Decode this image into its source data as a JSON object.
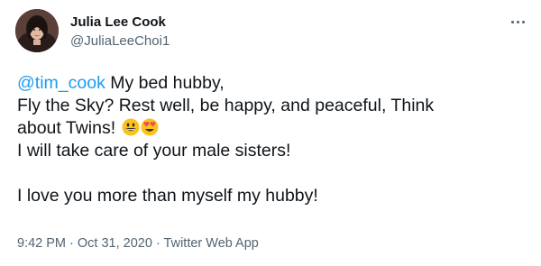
{
  "author": {
    "display_name": "Julia Lee Cook",
    "handle": "@JuliaLeeChoi1"
  },
  "tweet": {
    "mention": "@tim_cook",
    "line1_rest": " My bed hubby,",
    "line2": "Fly the Sky? Rest well, be happy, and peaceful, Think",
    "line3": "about Twins! ",
    "line4": "I will take care of your male sisters!",
    "line5": "I love you more than myself my hubby!",
    "emojis": [
      "grinning-face-emoji",
      "smiling-face-with-heart-eyes-emoji"
    ]
  },
  "meta": {
    "time": "9:42 PM",
    "separator": " · ",
    "date": "Oct 31, 2020",
    "source": "Twitter Web App"
  },
  "colors": {
    "link": "#1d9bf0",
    "text": "#0f1419",
    "secondary": "#536471"
  }
}
